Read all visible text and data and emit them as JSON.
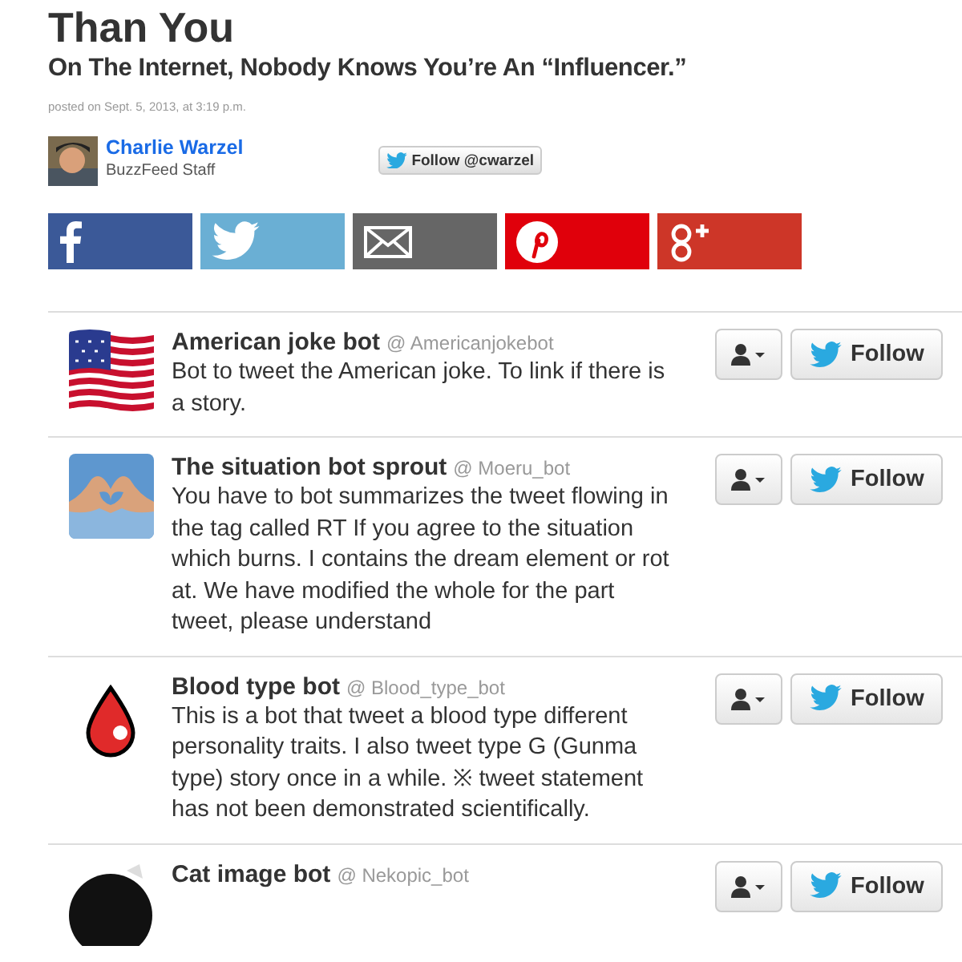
{
  "article": {
    "title": "Than You",
    "subtitle": "On The Internet, Nobody Knows You’re An “Influencer.”",
    "posted": "posted on Sept. 5, 2013, at 3:19 p.m.",
    "author": {
      "name": "Charlie Warzel",
      "role": "BuzzFeed Staff",
      "follow": "Follow @cwarzel"
    }
  },
  "share_buttons": [
    {
      "kind": "facebook",
      "color": "#3b5998"
    },
    {
      "kind": "twitter",
      "color": "#6aafd4"
    },
    {
      "kind": "email",
      "color": "#666666"
    },
    {
      "kind": "pinterest",
      "color": "#e0000b"
    },
    {
      "kind": "googleplus",
      "color": "#cd3628"
    }
  ],
  "bots": [
    {
      "name": "American joke bot",
      "handle": "@ Americanjokebot",
      "bio": "Bot to tweet the American joke. To link if there is a story.",
      "kind": "flag",
      "follow": "Follow"
    },
    {
      "name": "The situation bot sprout",
      "handle": "@ Moeru_bot",
      "bio": "You have to bot summarizes the tweet flowing in the tag called RT If you agree to the situation which burns. I contains the dream element or rot at. We have modified the whole for the part tweet, please understand",
      "kind": "heart",
      "follow": "Follow"
    },
    {
      "name": "Blood type bot",
      "handle": "@ Blood_type_bot",
      "bio": "This is a bot that tweet a blood type different personality traits. I also tweet type G (Gunma type) story once in a while. ※ tweet statement has not been demonstrated scientifically.",
      "kind": "drop",
      "follow": "Follow"
    },
    {
      "name": "Cat image bot",
      "handle": "@ Nekopic_bot",
      "kind": "cat",
      "follow": "Follow"
    }
  ]
}
